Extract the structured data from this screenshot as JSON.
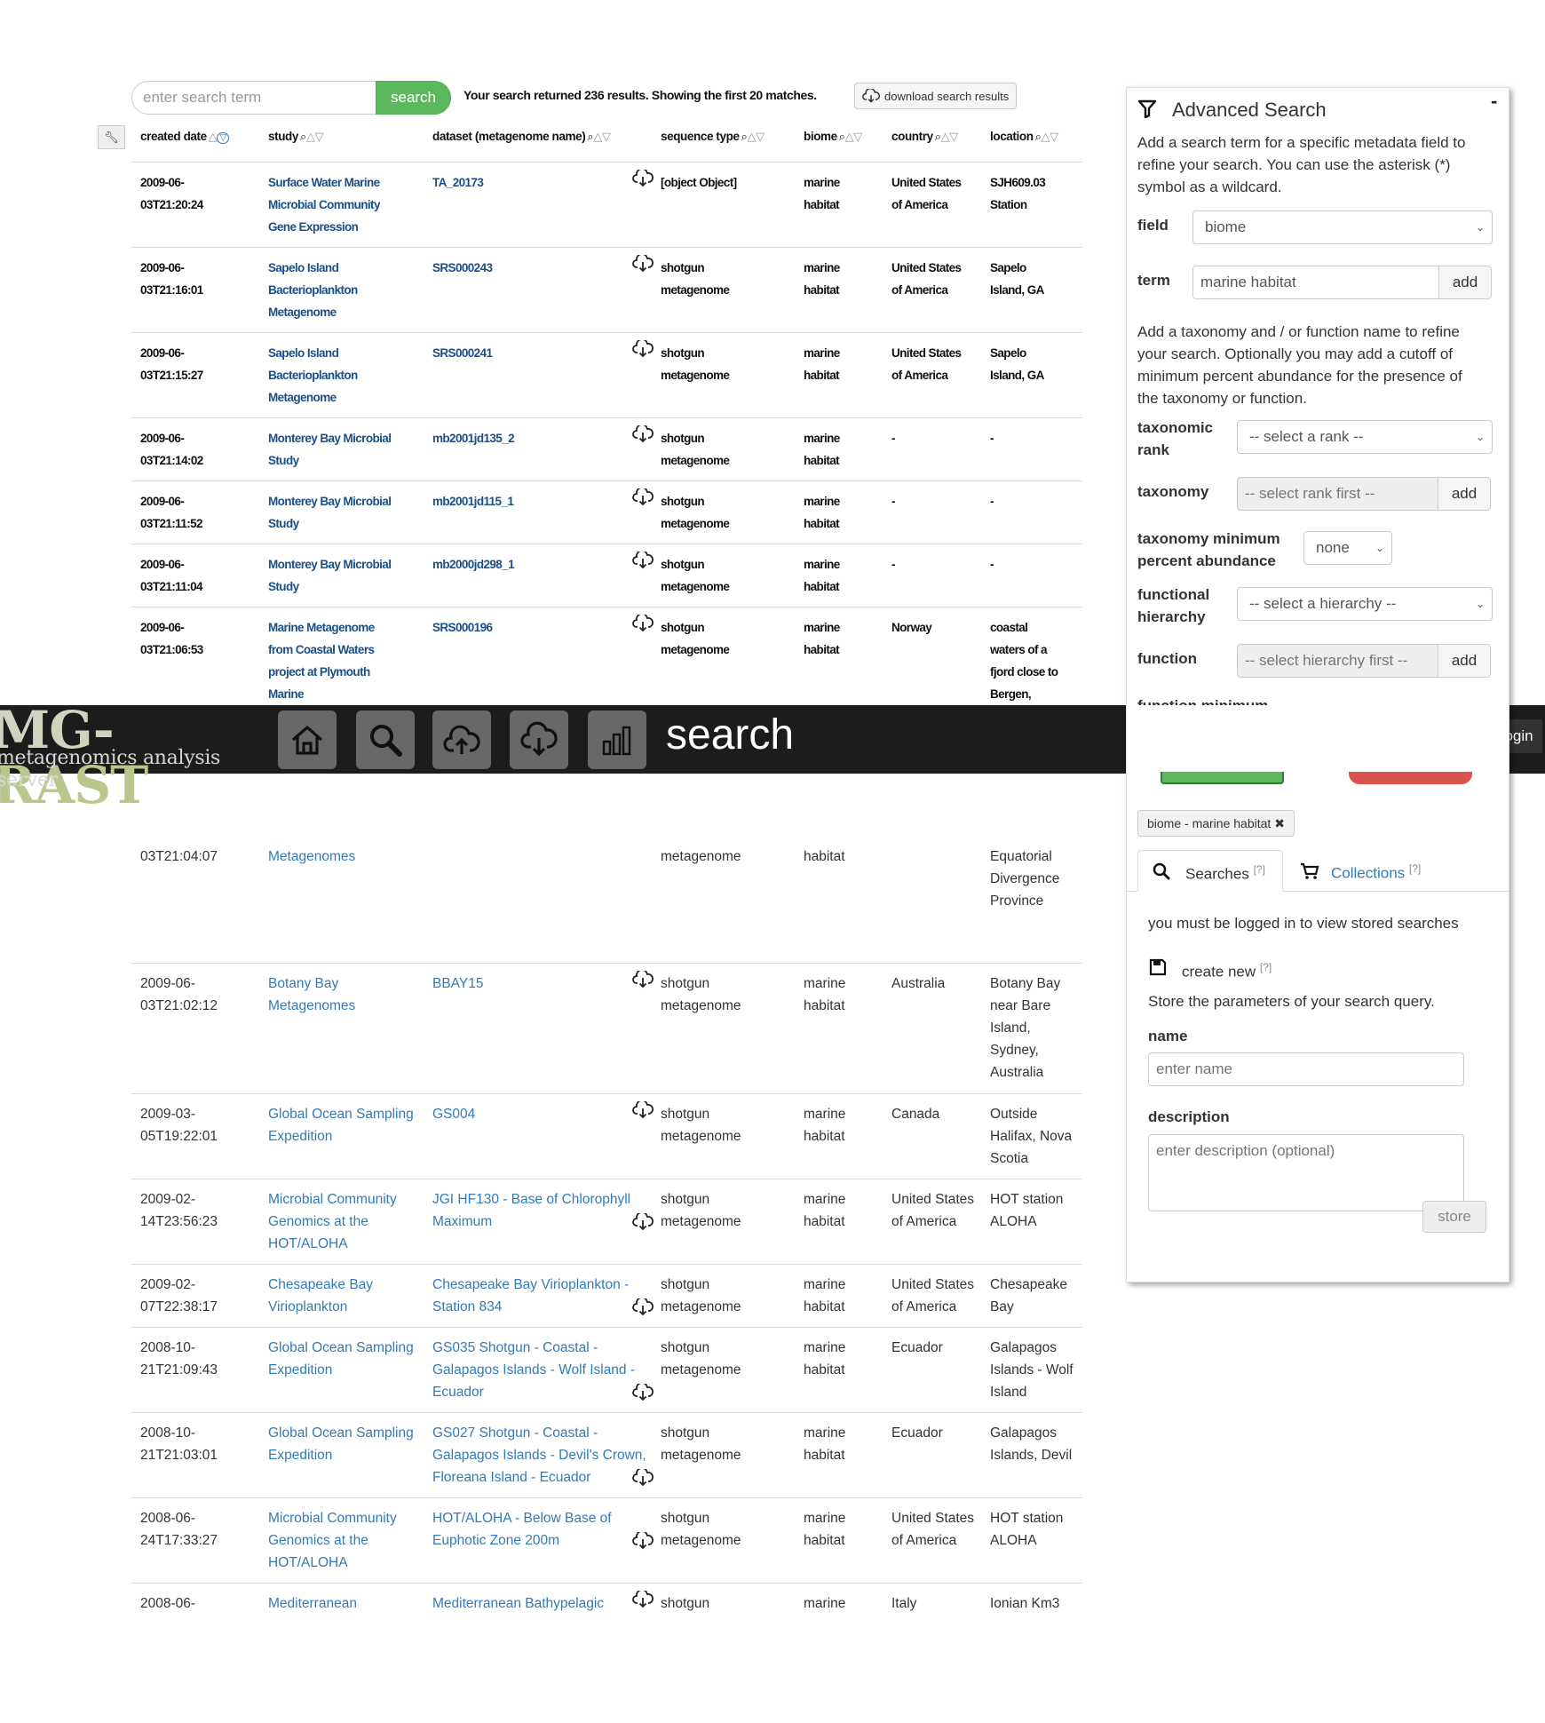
{
  "search": {
    "placeholder": "enter search term",
    "button_label": "search",
    "summary": "Your search returned 236 results. Showing the first 20 matches.",
    "download_label": "download search results"
  },
  "table": {
    "settings_icon": "wrench-icon",
    "columns": [
      "created date",
      "study",
      "dataset (metagenome name)",
      "sequence type",
      "biome",
      "country",
      "location"
    ],
    "rows": [
      {
        "date": [
          "2009-06-",
          "03T21:20:24"
        ],
        "study": [
          "Surface Water Marine",
          "Microbial Community",
          "Gene Expression"
        ],
        "dataset": [
          "TA_20173"
        ],
        "seqtype": [
          "[object Object]"
        ],
        "biome": [
          "marine",
          "habitat"
        ],
        "country": [
          "United States",
          "of America"
        ],
        "location": [
          "SJH609.03",
          "Station"
        ]
      },
      {
        "date": [
          "2009-06-",
          "03T21:16:01"
        ],
        "study": [
          "Sapelo Island",
          "Bacterioplankton",
          "Metagenome"
        ],
        "dataset": [
          "SRS000243"
        ],
        "seqtype": [
          "shotgun",
          "metagenome"
        ],
        "biome": [
          "marine",
          "habitat"
        ],
        "country": [
          "United States",
          "of America"
        ],
        "location": [
          "Sapelo",
          "Island, GA"
        ]
      },
      {
        "date": [
          "2009-06-",
          "03T21:15:27"
        ],
        "study": [
          "Sapelo Island",
          "Bacterioplankton",
          "Metagenome"
        ],
        "dataset": [
          "SRS000241"
        ],
        "seqtype": [
          "shotgun",
          "metagenome"
        ],
        "biome": [
          "marine",
          "habitat"
        ],
        "country": [
          "United States",
          "of America"
        ],
        "location": [
          "Sapelo",
          "Island, GA"
        ]
      },
      {
        "date": [
          "2009-06-",
          "03T21:14:02"
        ],
        "study": [
          "Monterey Bay Microbial",
          "Study"
        ],
        "dataset": [
          "mb2001jd135_2"
        ],
        "seqtype": [
          "shotgun",
          "metagenome"
        ],
        "biome": [
          "marine",
          "habitat"
        ],
        "country": [
          "-"
        ],
        "location": [
          "-"
        ]
      },
      {
        "date": [
          "2009-06-",
          "03T21:11:52"
        ],
        "study": [
          "Monterey Bay Microbial",
          "Study"
        ],
        "dataset": [
          "mb2001jd115_1"
        ],
        "seqtype": [
          "shotgun",
          "metagenome"
        ],
        "biome": [
          "marine",
          "habitat"
        ],
        "country": [
          "-"
        ],
        "location": [
          "-"
        ]
      },
      {
        "date": [
          "2009-06-",
          "03T21:11:04"
        ],
        "study": [
          "Monterey Bay Microbial",
          "Study"
        ],
        "dataset": [
          "mb2000jd298_1"
        ],
        "seqtype": [
          "shotgun",
          "metagenome"
        ],
        "biome": [
          "marine",
          "habitat"
        ],
        "country": [
          "-"
        ],
        "location": [
          "-"
        ]
      },
      {
        "date": [
          "2009-06-",
          "03T21:06:53"
        ],
        "study": [
          "Marine Metagenome",
          "from Coastal Waters",
          "project at Plymouth",
          "Marine"
        ],
        "dataset": [
          "SRS000196"
        ],
        "seqtype": [
          "shotgun",
          "metagenome"
        ],
        "biome": [
          "marine",
          "habitat"
        ],
        "country": [
          "Norway"
        ],
        "location": [
          "coastal",
          "waters of a",
          "fjord close to",
          "Bergen,"
        ]
      },
      {
        "date": [
          "03T21:04:07"
        ],
        "study": [
          "Metagenomes"
        ],
        "dataset": [],
        "seqtype": [
          "metagenome"
        ],
        "biome": [
          "habitat"
        ],
        "country": [],
        "location": [
          "Equatorial",
          "Divergence",
          "Province"
        ]
      },
      {
        "date": [
          "2009-06-",
          "03T21:02:12"
        ],
        "study": [
          "Botany Bay",
          "Metagenomes"
        ],
        "dataset": [
          "BBAY15"
        ],
        "seqtype": [
          "shotgun",
          "metagenome"
        ],
        "biome": [
          "marine",
          "habitat"
        ],
        "country": [
          "Australia"
        ],
        "location": [
          "Botany Bay",
          "near Bare",
          "Island,",
          "Sydney,",
          "Australia"
        ]
      },
      {
        "date": [
          "2009-03-",
          "05T19:22:01"
        ],
        "study": [
          "Global Ocean Sampling",
          "Expedition"
        ],
        "dataset": [
          "GS004"
        ],
        "seqtype": [
          "shotgun",
          "metagenome"
        ],
        "biome": [
          "marine",
          "habitat"
        ],
        "country": [
          "Canada"
        ],
        "location": [
          "Outside",
          "Halifax, Nova",
          "Scotia"
        ]
      },
      {
        "date": [
          "2009-02-",
          "14T23:56:23"
        ],
        "study": [
          "Microbial Community",
          "Genomics at the",
          "HOT/ALOHA"
        ],
        "dataset": [
          "JGI HF130 - Base of Chlorophyll",
          "Maximum"
        ],
        "seqtype": [
          "shotgun",
          "metagenome"
        ],
        "biome": [
          "marine",
          "habitat"
        ],
        "country": [
          "United States",
          "of America"
        ],
        "location": [
          "HOT station",
          "ALOHA"
        ]
      },
      {
        "date": [
          "2009-02-",
          "07T22:38:17"
        ],
        "study": [
          "Chesapeake Bay",
          "Virioplankton"
        ],
        "dataset": [
          "Chesapeake Bay Virioplankton -",
          "Station 834"
        ],
        "seqtype": [
          "shotgun",
          "metagenome"
        ],
        "biome": [
          "marine",
          "habitat"
        ],
        "country": [
          "United States",
          "of America"
        ],
        "location": [
          "Chesapeake",
          "Bay"
        ]
      },
      {
        "date": [
          "2008-10-",
          "21T21:09:43"
        ],
        "study": [
          "Global Ocean Sampling",
          "Expedition"
        ],
        "dataset": [
          "GS035 Shotgun - Coastal -",
          "Galapagos Islands - Wolf Island -",
          "Ecuador"
        ],
        "seqtype": [
          "shotgun",
          "metagenome"
        ],
        "biome": [
          "marine",
          "habitat"
        ],
        "country": [
          "Ecuador"
        ],
        "location": [
          "Galapagos",
          "Islands - Wolf",
          "Island"
        ]
      },
      {
        "date": [
          "2008-10-",
          "21T21:03:01"
        ],
        "study": [
          "Global Ocean Sampling",
          "Expedition"
        ],
        "dataset": [
          "GS027 Shotgun - Coastal -",
          "Galapagos Islands - Devil's Crown,",
          "Floreana Island - Ecuador"
        ],
        "seqtype": [
          "shotgun",
          "metagenome"
        ],
        "biome": [
          "marine",
          "habitat"
        ],
        "country": [
          "Ecuador"
        ],
        "location": [
          "Galapagos",
          "Islands, Devil"
        ]
      },
      {
        "date": [
          "2008-06-",
          "24T17:33:27"
        ],
        "study": [
          "Microbial Community",
          "Genomics at the",
          "HOT/ALOHA"
        ],
        "dataset": [
          "HOT/ALOHA - Below Base of",
          "Euphotic Zone 200m"
        ],
        "seqtype": [
          "shotgun",
          "metagenome"
        ],
        "biome": [
          "marine",
          "habitat"
        ],
        "country": [
          "United States",
          "of America"
        ],
        "location": [
          "HOT station",
          "ALOHA"
        ]
      },
      {
        "date": [
          "2008-06-"
        ],
        "study": [
          "Mediterranean"
        ],
        "dataset": [
          "Mediterranean Bathypelagic"
        ],
        "seqtype": [
          "shotgun"
        ],
        "biome": [
          "marine"
        ],
        "country": [
          "Italy"
        ],
        "location": [
          "Ionian Km3"
        ]
      }
    ]
  },
  "navbar": {
    "logo_main_a": "MG-",
    "logo_main_b": "RAST",
    "logo_sub": "metagenomics analysis server",
    "buttons": [
      "home-icon",
      "search-icon",
      "upload-icon",
      "download-icon",
      "analysis-icon"
    ],
    "title": "search",
    "help_label": "?",
    "login_label": "Login"
  },
  "advanced": {
    "title": "Advanced Search",
    "collapse_label": "-",
    "intro": [
      "Add a search term for a specific metadata field to",
      "refine your search. You can use the asterisk (*)",
      "symbol as a wildcard."
    ],
    "field_label": "field",
    "field_value": "biome",
    "term_label": "term",
    "term_value": "marine habitat",
    "add_label": "add",
    "tax_intro": [
      "Add a taxonomy and / or function name to refine",
      "your search. Optionally you may add a cutoff of",
      "minimum percent abundance for the presence of",
      "the taxonomy or function."
    ],
    "rank_label": [
      "taxonomic",
      "rank"
    ],
    "rank_value": "-- select a rank --",
    "taxonomy_label": "taxonomy",
    "taxonomy_placeholder": "-- select rank first --",
    "tax_min_label": [
      "taxonomy minimum",
      "percent abundance"
    ],
    "tax_min_value": "none",
    "hierarchy_label": [
      "functional",
      "hierarchy"
    ],
    "hierarchy_value": "-- select a hierarchy --",
    "function_label": "function",
    "function_placeholder": "-- select hierarchy first --",
    "func_min_label": "function minimum",
    "filter_tag": "biome - marine habitat",
    "tab_searches": "Searches",
    "tab_collections": "Collections",
    "help_mark": "[?]",
    "login_notice": "you must be logged in to view stored searches",
    "create_new": "create new",
    "store_hint": "Store the parameters of your search query.",
    "name_label": "name",
    "name_placeholder": "enter name",
    "description_label": "description",
    "description_placeholder": "enter description (optional)",
    "store_label": "store"
  }
}
